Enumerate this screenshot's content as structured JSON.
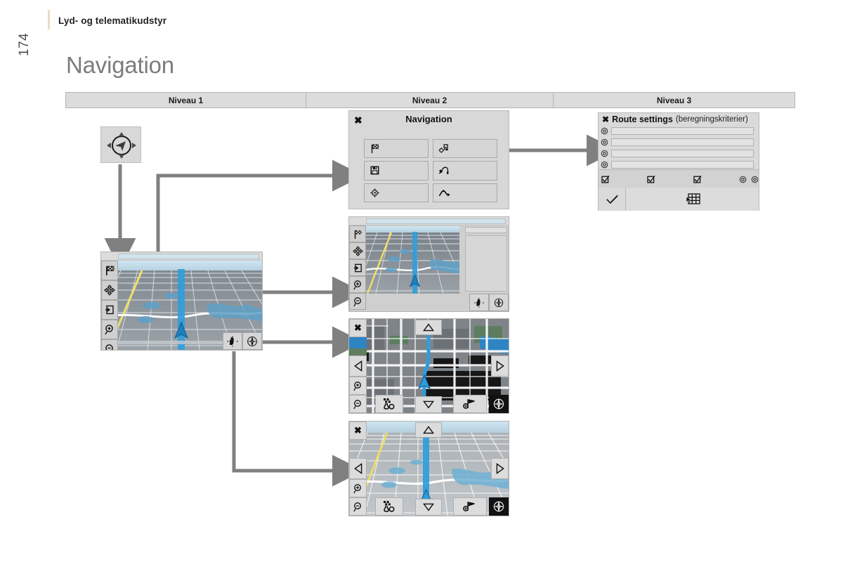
{
  "header": {
    "breadcrumb": "Lyd- og telematikudstyr",
    "page_number": "174",
    "title": "Navigation",
    "accent_color": "#e8dcc4"
  },
  "niveau_table": {
    "columns": [
      {
        "label": "Niveau 1"
      },
      {
        "label": "Niveau 2"
      },
      {
        "label": "Niveau 3"
      }
    ],
    "header_bg": "#dcdcdc",
    "border_color": "#b4b4b4"
  },
  "niveau1": {
    "compass_widget": {
      "name": "navigation-compass-widget",
      "icon": "compass-arrow-icon"
    },
    "map_screen": {
      "name": "map-3d-perspective",
      "rail_icons": [
        "checkered-flag-icon",
        "four-way-move-icon",
        "exit-arrow-box-icon",
        "zoom-in-icon",
        "zoom-out-icon"
      ],
      "corner_icons": [
        "hand-pan-icon",
        "compass-rose-icon"
      ]
    }
  },
  "niveau2": {
    "nav_panel": {
      "close_icon": "close-x-icon",
      "title": "Navigation",
      "buttons": [
        {
          "icon": "checkered-flag-icon"
        },
        {
          "icon": "route-settings-icon"
        },
        {
          "icon": "floppy-save-icon"
        },
        {
          "icon": "voice-headset-icon"
        },
        {
          "icon": "compass-target-icon"
        },
        {
          "icon": "route-curve-icon"
        }
      ]
    },
    "map_with_panel": {
      "name": "map-3d-with-info-panel",
      "rail_icons": [
        "checkered-flag-icon",
        "four-way-move-icon",
        "exit-arrow-box-icon",
        "zoom-in-icon",
        "zoom-out-icon"
      ],
      "corner_icons": [
        "hand-pan-icon",
        "compass-rose-icon"
      ]
    },
    "map_2d": {
      "name": "map-2d-top-down",
      "close_icon": "close-x-icon",
      "pan_icons": [
        "pan-up-icon",
        "pan-left-icon",
        "pan-right-icon",
        "pan-down-icon"
      ],
      "rail_icons": [
        "zoom-in-icon",
        "zoom-out-icon"
      ],
      "bottom_icons": [
        "poi-crossroads-icon",
        "waypoint-flag-icon",
        "compass-rose-icon"
      ]
    },
    "map_3d_pan": {
      "name": "map-3d-pan-mode",
      "close_icon": "close-x-icon",
      "pan_icons": [
        "pan-up-icon",
        "pan-left-icon",
        "pan-right-icon",
        "pan-down-icon"
      ],
      "rail_icons": [
        "zoom-in-icon",
        "zoom-out-icon"
      ],
      "bottom_icons": [
        "poi-crossroads-icon",
        "waypoint-flag-icon",
        "compass-rose-icon"
      ]
    }
  },
  "niveau3": {
    "route_settings": {
      "close_icon": "close-x-icon",
      "title": "Route settings",
      "subtitle": "(beregningskriterier)",
      "rows": [
        {
          "radio": "radio-icon",
          "value": ""
        },
        {
          "radio": "radio-icon",
          "value": ""
        },
        {
          "radio": "radio-icon",
          "value": ""
        },
        {
          "radio": "radio-icon",
          "value": ""
        }
      ],
      "tool_icons": [
        "checkbox-checked-icon",
        "checkbox-checked-icon",
        "checkbox-checked-icon"
      ],
      "tool_radios": [
        "radio-icon",
        "radio-icon"
      ],
      "confirm_icon": "checkmark-icon",
      "keyboard_icon": "keypad-grid-icon"
    }
  },
  "connectors": {
    "color": "#808080",
    "arrows": [
      {
        "name": "compass-to-map1",
        "desc": "from compass widget down to map screen"
      },
      {
        "name": "map1-to-nav-panel",
        "desc": "from map screen rail up and right to Navigation panel"
      },
      {
        "name": "navpanel-to-route-settings",
        "desc": "from Navigation route button right to Route settings"
      },
      {
        "name": "map1-to-map2",
        "desc": "from map screen right to map with info panel"
      },
      {
        "name": "map1-to-map3",
        "desc": "from compass corner right to 2D map"
      },
      {
        "name": "map1-to-map4",
        "desc": "from hand corner down and right to 3D pan map"
      }
    ]
  }
}
